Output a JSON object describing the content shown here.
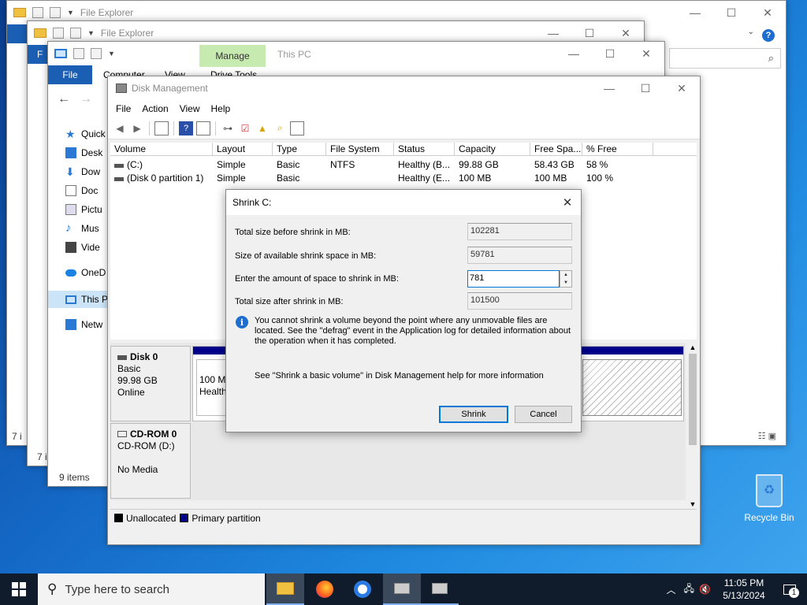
{
  "explorer_back2": {
    "title": "File Explorer"
  },
  "explorer_back1": {
    "title": "File Explorer",
    "file_tab": "F"
  },
  "explorer_front": {
    "ribbon_manage": "Manage",
    "title": "This PC",
    "file_tab": "File",
    "tabs": [
      "Computer",
      "View",
      "Drive Tools"
    ],
    "nav_items": [
      "Quick",
      "Desk",
      "Dow",
      "Doc",
      "Pictu",
      "Mus",
      "Vide",
      "OneD",
      "This P",
      "Netw"
    ],
    "status": "9 items",
    "status_back1": "7 i",
    "status_back2": "7 i"
  },
  "disk_mgmt": {
    "title": "Disk Management",
    "menu": [
      "File",
      "Action",
      "View",
      "Help"
    ],
    "columns": [
      "Volume",
      "Layout",
      "Type",
      "File System",
      "Status",
      "Capacity",
      "Free Spa...",
      "% Free"
    ],
    "rows": [
      [
        "(C:)",
        "Simple",
        "Basic",
        "NTFS",
        "Healthy (B...",
        "99.88 GB",
        "58.43 GB",
        "58 %"
      ],
      [
        "(Disk 0 partition 1)",
        "Simple",
        "Basic",
        "",
        "Healthy (E...",
        "100 MB",
        "100 MB",
        "100 %"
      ]
    ],
    "disk0": {
      "name": "Disk 0",
      "type": "Basic",
      "size": "99.98 GB",
      "status": "Online",
      "part1_size": "100 MB",
      "part1_status": "Healthy"
    },
    "cdrom0": {
      "name": "CD-ROM 0",
      "drive": "CD-ROM (D:)",
      "media": "No Media"
    },
    "legend": [
      "Unallocated",
      "Primary partition"
    ]
  },
  "dialog": {
    "title": "Shrink C:",
    "label_total_before": "Total size before shrink in MB:",
    "total_before": "102281",
    "label_available": "Size of available shrink space in MB:",
    "available": "59781",
    "label_amount": "Enter the amount of space to shrink in MB:",
    "amount": "781",
    "label_total_after": "Total size after shrink in MB:",
    "total_after": "101500",
    "info_text": "You cannot shrink a volume beyond the point where any unmovable files are located. See the \"defrag\" event in the Application log for detailed information about the operation when it has completed.",
    "help_text": "See \"Shrink a basic volume\" in Disk Management help for more information",
    "shrink_button": "Shrink",
    "cancel_button": "Cancel"
  },
  "desktop": {
    "recycle_bin": "Recycle Bin"
  },
  "taskbar": {
    "search_placeholder": "Type here to search",
    "time": "11:05 PM",
    "date": "5/13/2024",
    "notification_count": "1"
  },
  "colors": {
    "accent": "#0078d7",
    "file_tab": "#1a5fb4",
    "manage_tab": "#c6eab0",
    "primary_partition": "#00008b",
    "taskbar": "#101c2c"
  }
}
